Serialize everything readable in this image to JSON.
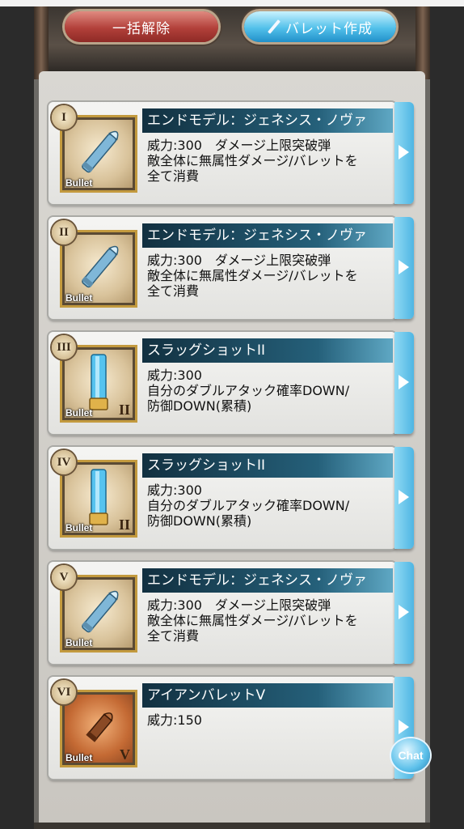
{
  "header": {
    "release_all_label": "一括解除",
    "create_pallet_label": "バレット作成"
  },
  "cards": [
    {
      "numeral": "I",
      "title": "エンドモデル：ジェネシス・ノヴァ",
      "description": "威力:300　ダメージ上限突破弾\n敵全体に無属性ダメージ/バレットを\n全て消費",
      "icon_label": "Bullet",
      "rank": "",
      "art": "silver-rifle-bullet"
    },
    {
      "numeral": "II",
      "title": "エンドモデル：ジェネシス・ノヴァ",
      "description": "威力:300　ダメージ上限突破弾\n敵全体に無属性ダメージ/バレットを\n全て消費",
      "icon_label": "Bullet",
      "rank": "",
      "art": "silver-rifle-bullet"
    },
    {
      "numeral": "III",
      "title": "スラッグショットII",
      "description": "威力:300\n自分のダブルアタック確率DOWN/\n防御DOWN(累積)",
      "icon_label": "Bullet",
      "rank": "II",
      "art": "blue-shotgun-shell"
    },
    {
      "numeral": "IV",
      "title": "スラッグショットII",
      "description": "威力:300\n自分のダブルアタック確率DOWN/\n防御DOWN(累積)",
      "icon_label": "Bullet",
      "rank": "II",
      "art": "blue-shotgun-shell"
    },
    {
      "numeral": "V",
      "title": "エンドモデル：ジェネシス・ノヴァ",
      "description": "威力:300　ダメージ上限突破弾\n敵全体に無属性ダメージ/バレットを\n全て消費",
      "icon_label": "Bullet",
      "rank": "",
      "art": "silver-rifle-bullet"
    },
    {
      "numeral": "VI",
      "title": "アイアンバレットV",
      "description": "威力:150",
      "icon_label": "Bullet",
      "rank": "V",
      "art": "copper-bullet"
    }
  ],
  "chat": {
    "label": "Chat"
  },
  "colors": {
    "accent_blue": "#4fb6e3",
    "title_bar": "#1d4f66",
    "red_button": "#b2403a",
    "gold_frame": "#c39a3e"
  }
}
